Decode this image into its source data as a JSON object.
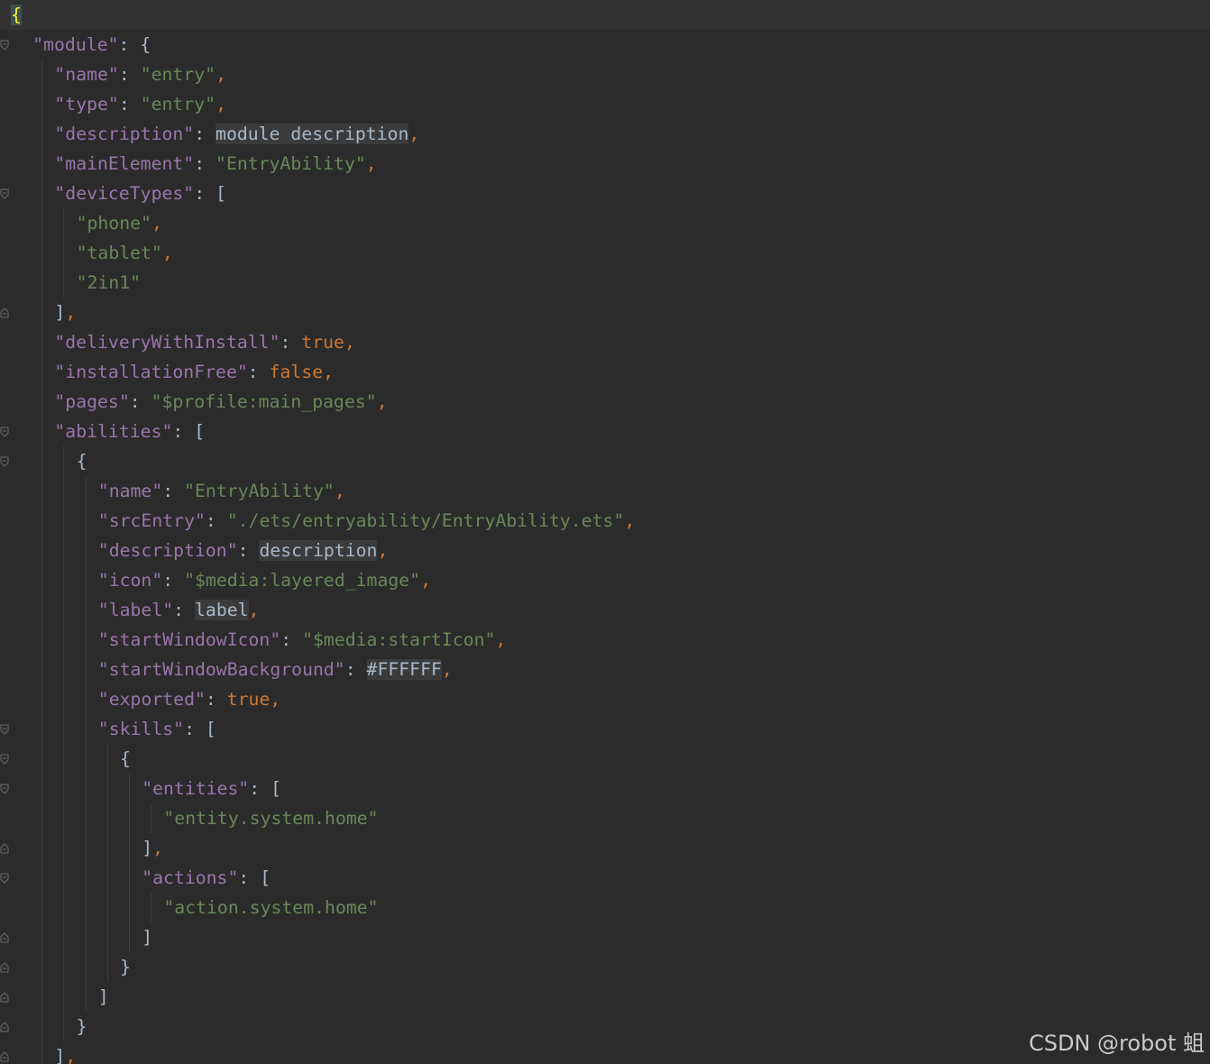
{
  "watermark": "CSDN @robot 蛆",
  "lines": [
    {
      "indent": 0,
      "current": true,
      "tokens": [
        {
          "t": "{",
          "c": "brace-hl"
        }
      ]
    },
    {
      "indent": 1,
      "tokens": [
        {
          "t": "\"module\"",
          "c": "k"
        },
        {
          "t": ": {",
          "c": "p"
        }
      ]
    },
    {
      "indent": 2,
      "tokens": [
        {
          "t": "\"name\"",
          "c": "k"
        },
        {
          "t": ": ",
          "c": "p"
        },
        {
          "t": "\"entry\"",
          "c": "s"
        },
        {
          "t": ",",
          "c": "c"
        }
      ]
    },
    {
      "indent": 2,
      "tokens": [
        {
          "t": "\"type\"",
          "c": "k"
        },
        {
          "t": ": ",
          "c": "p"
        },
        {
          "t": "\"entry\"",
          "c": "s"
        },
        {
          "t": ",",
          "c": "c"
        }
      ]
    },
    {
      "indent": 2,
      "tokens": [
        {
          "t": "\"description\"",
          "c": "k"
        },
        {
          "t": ": ",
          "c": "p"
        },
        {
          "t": "module description",
          "c": "u"
        },
        {
          "t": ",",
          "c": "c"
        }
      ]
    },
    {
      "indent": 2,
      "tokens": [
        {
          "t": "\"mainElement\"",
          "c": "k"
        },
        {
          "t": ": ",
          "c": "p"
        },
        {
          "t": "\"EntryAbility\"",
          "c": "s"
        },
        {
          "t": ",",
          "c": "c"
        }
      ]
    },
    {
      "indent": 2,
      "tokens": [
        {
          "t": "\"deviceTypes\"",
          "c": "k"
        },
        {
          "t": ": [",
          "c": "p"
        }
      ]
    },
    {
      "indent": 3,
      "tokens": [
        {
          "t": "\"phone\"",
          "c": "s"
        },
        {
          "t": ",",
          "c": "c"
        }
      ]
    },
    {
      "indent": 3,
      "tokens": [
        {
          "t": "\"tablet\"",
          "c": "s"
        },
        {
          "t": ",",
          "c": "c"
        }
      ]
    },
    {
      "indent": 3,
      "tokens": [
        {
          "t": "\"2in1\"",
          "c": "s"
        }
      ]
    },
    {
      "indent": 2,
      "tokens": [
        {
          "t": "]",
          "c": "p"
        },
        {
          "t": ",",
          "c": "c"
        }
      ]
    },
    {
      "indent": 2,
      "tokens": [
        {
          "t": "\"deliveryWithInstall\"",
          "c": "k"
        },
        {
          "t": ": ",
          "c": "p"
        },
        {
          "t": "true",
          "c": "b"
        },
        {
          "t": ",",
          "c": "c"
        }
      ]
    },
    {
      "indent": 2,
      "tokens": [
        {
          "t": "\"installationFree\"",
          "c": "k"
        },
        {
          "t": ": ",
          "c": "p"
        },
        {
          "t": "false",
          "c": "b"
        },
        {
          "t": ",",
          "c": "c"
        }
      ]
    },
    {
      "indent": 2,
      "tokens": [
        {
          "t": "\"pages\"",
          "c": "k"
        },
        {
          "t": ": ",
          "c": "p"
        },
        {
          "t": "\"$profile:main_pages\"",
          "c": "s"
        },
        {
          "t": ",",
          "c": "c"
        }
      ]
    },
    {
      "indent": 2,
      "tokens": [
        {
          "t": "\"abilities\"",
          "c": "k"
        },
        {
          "t": ": [",
          "c": "p"
        }
      ]
    },
    {
      "indent": 3,
      "tokens": [
        {
          "t": "{",
          "c": "p"
        }
      ]
    },
    {
      "indent": 4,
      "tokens": [
        {
          "t": "\"name\"",
          "c": "k"
        },
        {
          "t": ": ",
          "c": "p"
        },
        {
          "t": "\"EntryAbility\"",
          "c": "s"
        },
        {
          "t": ",",
          "c": "c"
        }
      ]
    },
    {
      "indent": 4,
      "tokens": [
        {
          "t": "\"srcEntry\"",
          "c": "k"
        },
        {
          "t": ": ",
          "c": "p"
        },
        {
          "t": "\"./ets/entryability/EntryAbility.ets\"",
          "c": "s"
        },
        {
          "t": ",",
          "c": "c"
        }
      ]
    },
    {
      "indent": 4,
      "tokens": [
        {
          "t": "\"description\"",
          "c": "k"
        },
        {
          "t": ": ",
          "c": "p"
        },
        {
          "t": "description",
          "c": "u"
        },
        {
          "t": ",",
          "c": "c"
        }
      ]
    },
    {
      "indent": 4,
      "tokens": [
        {
          "t": "\"icon\"",
          "c": "k"
        },
        {
          "t": ": ",
          "c": "p"
        },
        {
          "t": "\"$media:layered_image\"",
          "c": "s"
        },
        {
          "t": ",",
          "c": "c"
        }
      ]
    },
    {
      "indent": 4,
      "tokens": [
        {
          "t": "\"label\"",
          "c": "k"
        },
        {
          "t": ": ",
          "c": "p"
        },
        {
          "t": "label",
          "c": "u"
        },
        {
          "t": ",",
          "c": "c"
        }
      ]
    },
    {
      "indent": 4,
      "tokens": [
        {
          "t": "\"startWindowIcon\"",
          "c": "k"
        },
        {
          "t": ": ",
          "c": "p"
        },
        {
          "t": "\"$media:startIcon\"",
          "c": "s"
        },
        {
          "t": ",",
          "c": "c"
        }
      ]
    },
    {
      "indent": 4,
      "tokens": [
        {
          "t": "\"startWindowBackground\"",
          "c": "k"
        },
        {
          "t": ": ",
          "c": "p"
        },
        {
          "t": "#FFFFFF",
          "c": "u"
        },
        {
          "t": ",",
          "c": "c"
        }
      ]
    },
    {
      "indent": 4,
      "tokens": [
        {
          "t": "\"exported\"",
          "c": "k"
        },
        {
          "t": ": ",
          "c": "p"
        },
        {
          "t": "true",
          "c": "b"
        },
        {
          "t": ",",
          "c": "c"
        }
      ]
    },
    {
      "indent": 4,
      "tokens": [
        {
          "t": "\"skills\"",
          "c": "k"
        },
        {
          "t": ": [",
          "c": "p"
        }
      ]
    },
    {
      "indent": 5,
      "tokens": [
        {
          "t": "{",
          "c": "p"
        }
      ]
    },
    {
      "indent": 6,
      "tokens": [
        {
          "t": "\"entities\"",
          "c": "k"
        },
        {
          "t": ": [",
          "c": "p"
        }
      ]
    },
    {
      "indent": 7,
      "tokens": [
        {
          "t": "\"entity.system.home\"",
          "c": "s"
        }
      ]
    },
    {
      "indent": 6,
      "tokens": [
        {
          "t": "]",
          "c": "p"
        },
        {
          "t": ",",
          "c": "c"
        }
      ]
    },
    {
      "indent": 6,
      "tokens": [
        {
          "t": "\"actions\"",
          "c": "k"
        },
        {
          "t": ": [",
          "c": "p"
        }
      ]
    },
    {
      "indent": 7,
      "tokens": [
        {
          "t": "\"action.system.home\"",
          "c": "s"
        }
      ]
    },
    {
      "indent": 6,
      "tokens": [
        {
          "t": "]",
          "c": "p"
        }
      ]
    },
    {
      "indent": 5,
      "tokens": [
        {
          "t": "}",
          "c": "p"
        }
      ]
    },
    {
      "indent": 4,
      "tokens": [
        {
          "t": "]",
          "c": "p"
        }
      ]
    },
    {
      "indent": 3,
      "tokens": [
        {
          "t": "}",
          "c": "p"
        }
      ]
    },
    {
      "indent": 2,
      "tokens": [
        {
          "t": "]",
          "c": "p"
        },
        {
          "t": ",",
          "c": "c"
        }
      ]
    }
  ],
  "fold_markers": [
    {
      "line": 0,
      "kind": "open"
    },
    {
      "line": 1,
      "kind": "open"
    },
    {
      "line": 6,
      "kind": "open"
    },
    {
      "line": 10,
      "kind": "close"
    },
    {
      "line": 14,
      "kind": "open"
    },
    {
      "line": 15,
      "kind": "open"
    },
    {
      "line": 24,
      "kind": "open"
    },
    {
      "line": 25,
      "kind": "open"
    },
    {
      "line": 26,
      "kind": "open"
    },
    {
      "line": 28,
      "kind": "close"
    },
    {
      "line": 29,
      "kind": "open"
    },
    {
      "line": 31,
      "kind": "close"
    },
    {
      "line": 32,
      "kind": "close"
    },
    {
      "line": 33,
      "kind": "close"
    },
    {
      "line": 34,
      "kind": "close"
    },
    {
      "line": 35,
      "kind": "close"
    }
  ]
}
